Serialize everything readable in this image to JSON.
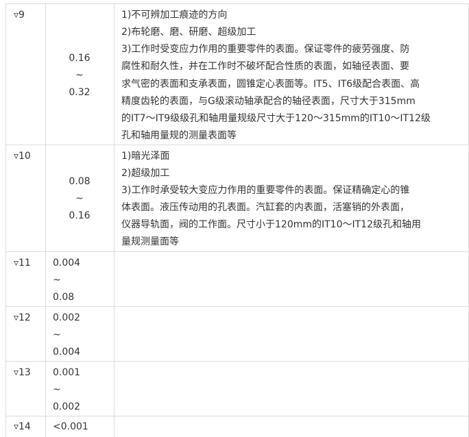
{
  "table": {
    "rows": [
      {
        "grade": "▿9",
        "ra": [
          "0.16",
          "~",
          "0.32"
        ],
        "desc": [
          "1)不可辨加工痕迹的方向",
          "2)布轮磨、磨、研磨、超级加工",
          "3)工作时受变应力作用的重要零件的表面。保证零件的疲劳强度、防",
          "腐性和耐久性，并在工作时不破坏配合性质的表面，如轴径表面、要",
          "求气密的表面和支承表面，圆锥定心表面等。IT5、IT6级配合表面、高",
          "精度齿轮的表面，与G级滚动轴承配合的轴径表面，尺寸大于315mm",
          "的IT7～IT9级级孔和轴用量规级尺寸大于120～315mm的IT10～IT12级",
          "孔和轴用量规的测量表面等"
        ]
      },
      {
        "grade": "▿10",
        "ra": [
          "0.08",
          "~",
          "0.16"
        ],
        "desc": [
          "1)暗光泽面",
          "2)超级加工",
          "3)工作时承受较大变应力作用的重要零件的表面。保证精确定心的锥",
          "体表面。液压传动用的孔表面。汽缸套的内表面，活塞销的外表面，",
          "仪器导轨面，阀的工作面。尺寸小于120mm的IT10～IT12级孔和轴用",
          "量规测量面等"
        ]
      },
      {
        "grade": "▿11",
        "ra": [
          "0.004",
          "~",
          "0.08"
        ],
        "desc": []
      },
      {
        "grade": "▿12",
        "ra": [
          "0.002",
          "~",
          "0.004"
        ],
        "desc": []
      },
      {
        "grade": "▿13",
        "ra": [
          "0.001",
          "~",
          "0.002"
        ],
        "desc": []
      },
      {
        "grade": "▿14",
        "ra": [
          "<0.001"
        ],
        "desc": []
      }
    ]
  }
}
